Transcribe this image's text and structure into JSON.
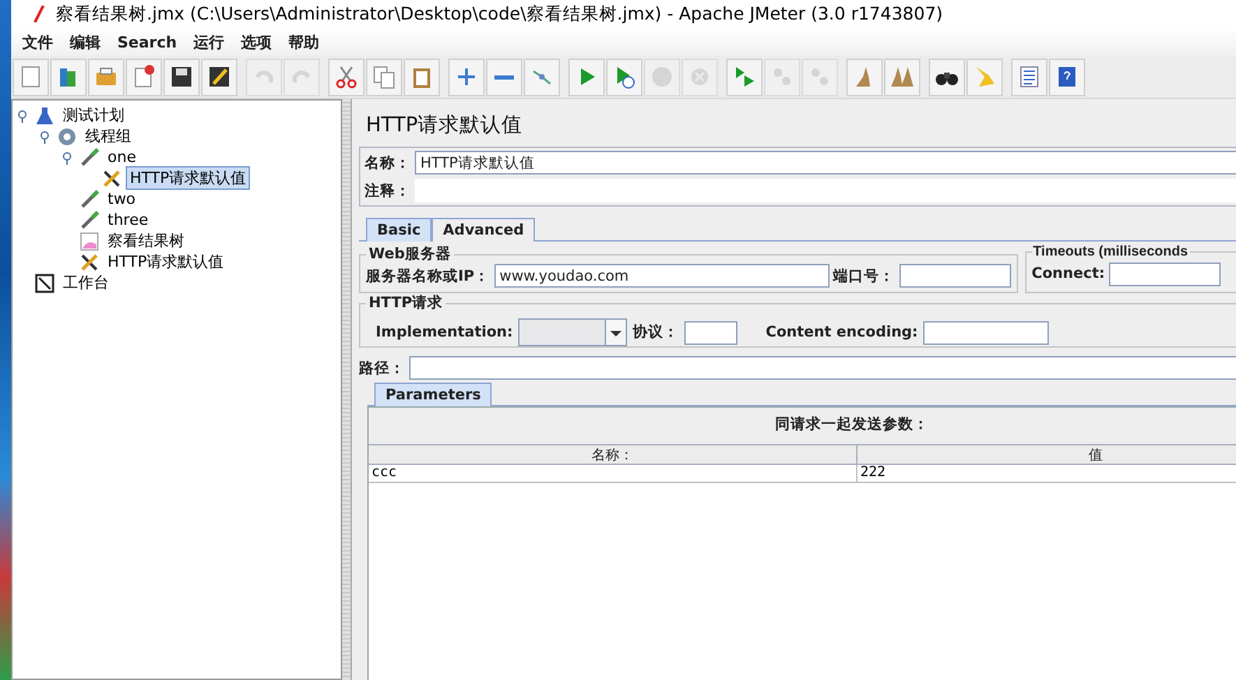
{
  "window": {
    "title": "察看结果树.jmx (C:\\Users\\Administrator\\Desktop\\code\\察看结果树.jmx) - Apache JMeter (3.0 r1743807)"
  },
  "menu": [
    "文件",
    "编辑",
    "Search",
    "运行",
    "选项",
    "帮助"
  ],
  "toolbar": [
    [
      {
        "kind": "new",
        "disabled": false
      },
      {
        "kind": "templates",
        "disabled": false
      },
      {
        "kind": "open",
        "disabled": false
      },
      {
        "kind": "close",
        "disabled": false
      },
      {
        "kind": "save",
        "disabled": false
      },
      {
        "kind": "save-as",
        "disabled": false
      }
    ],
    [
      {
        "kind": "undo",
        "disabled": true
      },
      {
        "kind": "redo",
        "disabled": true
      }
    ],
    [
      {
        "kind": "cut",
        "disabled": false
      },
      {
        "kind": "copy",
        "disabled": false
      },
      {
        "kind": "paste",
        "disabled": false
      }
    ],
    [
      {
        "kind": "expand",
        "disabled": false
      },
      {
        "kind": "collapse",
        "disabled": false
      },
      {
        "kind": "toggle",
        "disabled": false
      }
    ],
    [
      {
        "kind": "start",
        "disabled": false
      },
      {
        "kind": "start-no-pause",
        "disabled": false
      },
      {
        "kind": "stop",
        "disabled": true
      },
      {
        "kind": "shutdown",
        "disabled": true
      }
    ],
    [
      {
        "kind": "remote-start",
        "disabled": false
      },
      {
        "kind": "remote-stop",
        "disabled": true
      },
      {
        "kind": "remote-exit",
        "disabled": true
      }
    ],
    [
      {
        "kind": "clear",
        "disabled": false
      },
      {
        "kind": "clear-all",
        "disabled": false
      }
    ],
    [
      {
        "kind": "search",
        "disabled": false
      },
      {
        "kind": "reset-search",
        "disabled": false
      }
    ],
    [
      {
        "kind": "function",
        "disabled": false
      },
      {
        "kind": "help",
        "disabled": false
      }
    ]
  ],
  "tree": [
    {
      "label": "测试计划",
      "kind": "plan",
      "selected": false,
      "children": [
        {
          "label": "线程组",
          "kind": "threads",
          "selected": false,
          "children": [
            {
              "label": "one",
              "kind": "sampler",
              "selected": false,
              "children": [
                {
                  "label": "HTTP请求默认值",
                  "kind": "config",
                  "selected": true
                }
              ]
            },
            {
              "label": "two",
              "kind": "sampler",
              "selected": false
            },
            {
              "label": "three",
              "kind": "sampler",
              "selected": false
            },
            {
              "label": "察看结果树",
              "kind": "listener",
              "selected": false
            },
            {
              "label": "HTTP请求默认值",
              "kind": "config",
              "selected": false
            }
          ]
        }
      ]
    },
    {
      "label": "工作台",
      "kind": "workbench",
      "selected": false
    }
  ],
  "panel": {
    "title": "HTTP请求默认值",
    "name": {
      "label": "名称：",
      "value": "HTTP请求默认值"
    },
    "comment": {
      "label": "注释："
    },
    "tabs": [
      {
        "label": "Basic",
        "selected": true
      },
      {
        "label": "Advanced",
        "selected": false
      }
    ],
    "web_server": {
      "legend": "Web服务器",
      "server_label": "服务器名称或IP：",
      "server_value": "www.youdao.com",
      "port_label": "端口号："
    },
    "timeouts": {
      "legend": "Timeouts (milliseconds",
      "connect_label": "Connect:"
    },
    "http_request": {
      "legend": "HTTP请求",
      "implementation_label": "Implementation:",
      "protocol_label": "协议：",
      "encoding_label": "Content encoding:",
      "path_label": "路径："
    },
    "param_tabs": [
      {
        "label": "Parameters",
        "selected": true
      }
    ],
    "params": {
      "caption": "同请求一起发送参数：",
      "columns": [
        "名称：",
        "值"
      ],
      "rows": [
        [
          "ccc",
          "222"
        ]
      ]
    }
  }
}
